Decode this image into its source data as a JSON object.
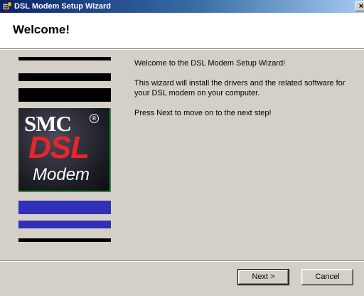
{
  "window": {
    "title": "DSL Modem Setup Wizard",
    "close_glyph": "×"
  },
  "header": {
    "title": "Welcome!"
  },
  "logo": {
    "brand": "SMC",
    "registered": "®",
    "product_line1": "DSL",
    "product_line2": "Modem"
  },
  "content": {
    "line1": "Welcome to the DSL Modem Setup Wizard!",
    "line2": "This wizard will install the drivers and the related software for your DSL modem on your computer.",
    "line3": "Press Next to move on to the next step!"
  },
  "buttons": {
    "next_label": "Next >",
    "cancel_label": "Cancel"
  },
  "colors": {
    "titlebar_start": "#0a246a",
    "titlebar_end": "#a6caf0",
    "dialog_bg": "#d4d0c8",
    "logo_red": "#e8262b",
    "stripe_blue": "#2f2fb8"
  },
  "icons": {
    "app": "setup-app-icon",
    "close": "close-icon"
  }
}
